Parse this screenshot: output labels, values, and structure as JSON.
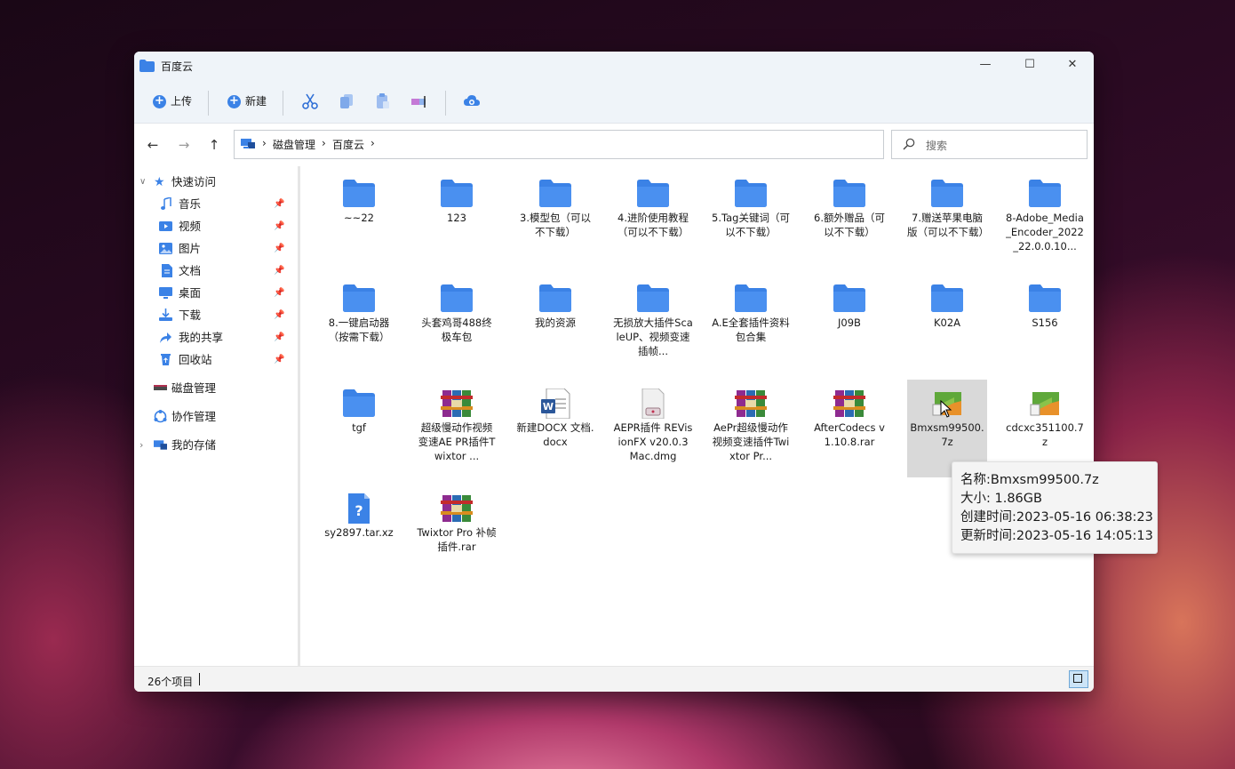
{
  "window": {
    "title": "百度云",
    "controls": {
      "minimize": "—",
      "maximize": "☐",
      "close": "✕"
    }
  },
  "toolbar": {
    "upload_label": "上传",
    "new_label": "新建",
    "icons": [
      "cut-icon",
      "copy-icon",
      "paste-icon",
      "rename-icon",
      "cloud-icon"
    ]
  },
  "nav": {
    "back": "←",
    "forward": "→",
    "up": "↑",
    "breadcrumb": [
      "磁盘管理",
      "百度云"
    ],
    "search_placeholder": "搜索"
  },
  "sidebar": {
    "quick_access_label": "快速访问",
    "quick_items": [
      {
        "label": "音乐",
        "icon": "music-icon"
      },
      {
        "label": "视频",
        "icon": "video-icon"
      },
      {
        "label": "图片",
        "icon": "picture-icon"
      },
      {
        "label": "文档",
        "icon": "document-icon"
      },
      {
        "label": "桌面",
        "icon": "desktop-icon"
      },
      {
        "label": "下载",
        "icon": "download-icon"
      },
      {
        "label": "我的共享",
        "icon": "share-icon"
      },
      {
        "label": "回收站",
        "icon": "recycle-bin-icon"
      }
    ],
    "disk_label": "磁盘管理",
    "collab_label": "协作管理",
    "storage_label": "我的存储"
  },
  "files": [
    {
      "name": "~~22",
      "type": "folder"
    },
    {
      "name": "123",
      "type": "folder"
    },
    {
      "name": "3.模型包（可以不下载）",
      "type": "folder"
    },
    {
      "name": "4.进阶使用教程（可以不下载）",
      "type": "folder"
    },
    {
      "name": "5.Tag关键词（可以不下载）",
      "type": "folder"
    },
    {
      "name": "6.额外赠品（可以不下载）",
      "type": "folder"
    },
    {
      "name": "7.赠送苹果电脑版（可以不下载）",
      "type": "folder"
    },
    {
      "name": "8-Adobe_Media_Encoder_2022_22.0.0.10...",
      "type": "folder"
    },
    {
      "name": "8.一键启动器（按需下载）",
      "type": "folder"
    },
    {
      "name": "头套鸡哥488终极车包",
      "type": "folder"
    },
    {
      "name": "我的资源",
      "type": "folder"
    },
    {
      "name": "无损放大插件ScaleUP、视频变速插帧...",
      "type": "folder"
    },
    {
      "name": "A.E全套插件资料包合集",
      "type": "folder"
    },
    {
      "name": "J09B",
      "type": "folder"
    },
    {
      "name": "K02A",
      "type": "folder"
    },
    {
      "name": "S156",
      "type": "folder"
    },
    {
      "name": "tgf",
      "type": "folder"
    },
    {
      "name": "超级慢动作视频变速AE PR插件Twixtor ...",
      "type": "rar"
    },
    {
      "name": "新建DOCX 文档.docx",
      "type": "docx"
    },
    {
      "name": "AEPR插件 REVisionFX v20.0.3 Mac.dmg",
      "type": "dmg"
    },
    {
      "name": "AePr超级慢动作视频变速插件Twixtor Pr...",
      "type": "rar"
    },
    {
      "name": "AfterCodecs v1.10.8.rar",
      "type": "rar"
    },
    {
      "name": "Bmxsm99500.7z",
      "type": "7z"
    },
    {
      "name": "cdcxc351100.7z",
      "type": "7z"
    },
    {
      "name": "sy2897.tar.xz",
      "type": "unknown"
    },
    {
      "name": "Twixtor Pro 补帧插件.rar",
      "type": "rar"
    }
  ],
  "status": {
    "count_text": "26个项目"
  },
  "tooltip": {
    "name": "名称:Bmxsm99500.7z",
    "size": "大小: 1.86GB",
    "created": "创建时间:2023-05-16 06:38:23",
    "updated": "更新时间:2023-05-16 14:05:13"
  },
  "colors": {
    "accent": "#3b82e6",
    "folder": "#4a90f0",
    "selected": "#d9d9d9"
  }
}
